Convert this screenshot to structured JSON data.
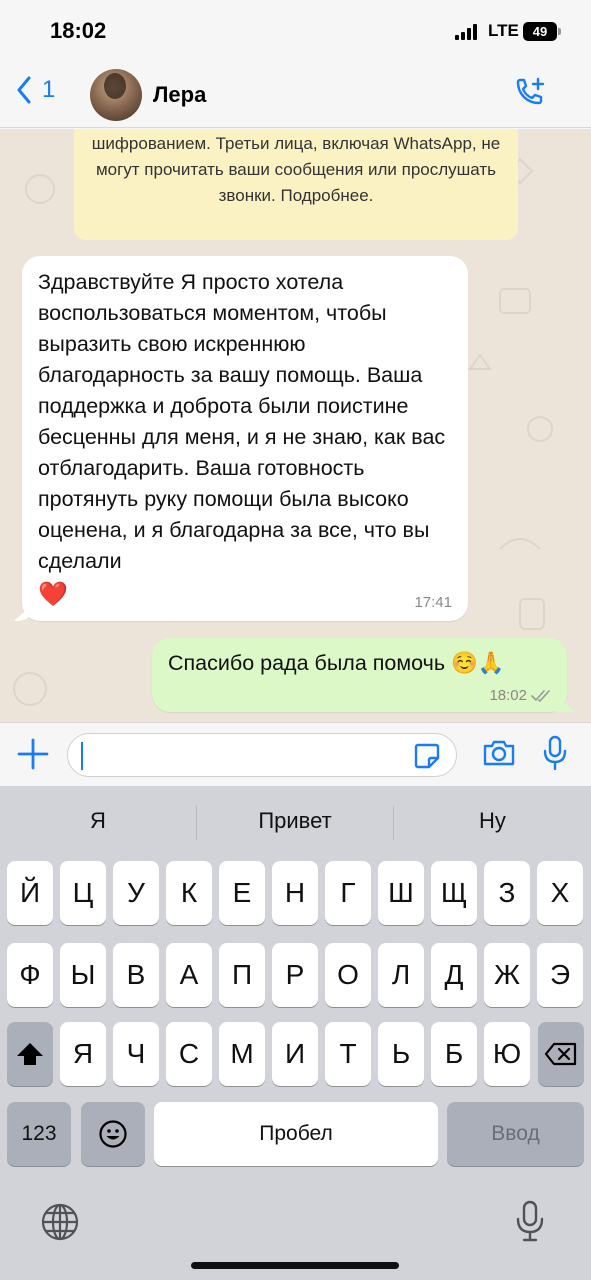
{
  "status_bar": {
    "time": "18:02",
    "network": "LTE",
    "battery": "49"
  },
  "header": {
    "back_count": "1",
    "contact_name": "Лера"
  },
  "chat": {
    "encryption_note": "шифрованием. Третьи лица, включая WhatsApp, не могут прочитать ваши сообщения или прослушать звонки. Подробнее.",
    "messages": [
      {
        "direction": "incoming",
        "text": "Здравствуйте Я просто хотела воспользоваться моментом, чтобы выразить свою искреннюю благодарность за вашу помощь. Ваша поддержка и доброта были поистине бесценны для меня, и я не знаю, как вас отблагодарить. Ваша готовность протянуть руку помощи была высоко оценена, и я благодарна за все, что вы сделали",
        "emoji": "❤️",
        "time": "17:41"
      },
      {
        "direction": "outgoing",
        "text": "Спасибо рада была помочь ☺️🙏",
        "time": "18:02",
        "status": "read"
      }
    ]
  },
  "input": {
    "value": "",
    "placeholder": ""
  },
  "keyboard": {
    "suggestions": [
      "Я",
      "Привет",
      "Ну"
    ],
    "row1": [
      "Й",
      "Ц",
      "У",
      "К",
      "Е",
      "Н",
      "Г",
      "Ш",
      "Щ",
      "З",
      "Х"
    ],
    "row2": [
      "Ф",
      "Ы",
      "В",
      "А",
      "П",
      "Р",
      "О",
      "Л",
      "Д",
      "Ж",
      "Э"
    ],
    "row3": [
      "Я",
      "Ч",
      "С",
      "М",
      "И",
      "Т",
      "Ь",
      "Б",
      "Ю"
    ],
    "numbers_key": "123",
    "space_key": "Пробел",
    "return_key": "Ввод"
  },
  "colors": {
    "accent": "#1a7cf5",
    "outgoing_bubble": "#dcf8c6",
    "note_background": "#fbf2c3",
    "chat_background": "#ece4d9"
  },
  "icons": [
    "back-chevron-icon",
    "call-add-icon",
    "plus-icon",
    "sticker-icon",
    "camera-icon",
    "mic-icon",
    "shift-icon",
    "backspace-icon",
    "emoji-icon",
    "globe-icon",
    "read-check-icon"
  ]
}
